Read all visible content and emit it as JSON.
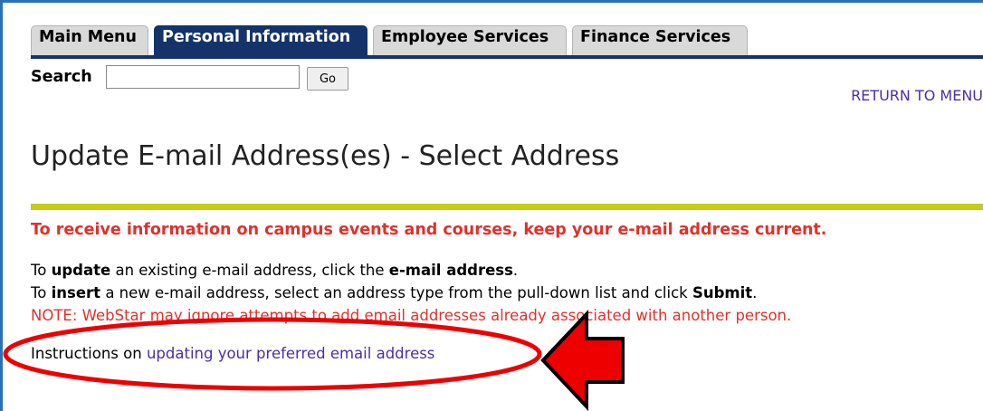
{
  "tabs": [
    {
      "label": "Main Menu",
      "active": false
    },
    {
      "label": "Personal Information",
      "active": true
    },
    {
      "label": "Employee Services",
      "active": false
    },
    {
      "label": "Finance Services",
      "active": false
    }
  ],
  "search": {
    "label": "Search",
    "value": "",
    "button_label": "Go"
  },
  "header": {
    "return_link": "RETURN TO MENU"
  },
  "page": {
    "title": "Update E-mail Address(es) - Select Address",
    "info_red": "To receive information on campus events and courses, keep your e-mail address current.",
    "line1": {
      "pre": "To ",
      "bold1": "update",
      "mid": " an existing e-mail address, click the ",
      "bold2": "e-mail address",
      "post": "."
    },
    "line2": {
      "pre": "To ",
      "bold1": "insert",
      "mid": " a new e-mail address, select an address type from the pull-down list and click ",
      "bold2": "Submit",
      "post": "."
    },
    "note": "NOTE: WebStar may ignore attempts to add email addresses already associated with another person.",
    "instructions_prefix": "Instructions on ",
    "instructions_link": "updating your preferred email address"
  },
  "colors": {
    "tab_active": "#14336b",
    "tab_inactive": "#d9d9d9",
    "link": "#4b2fa6",
    "alert_red": "#e0312a",
    "title_rule": "#c8cc14",
    "annotation_red": "#ee0000"
  },
  "annotations": {
    "highlight": "red-ellipse",
    "pointer": "red-arrow-icon"
  }
}
